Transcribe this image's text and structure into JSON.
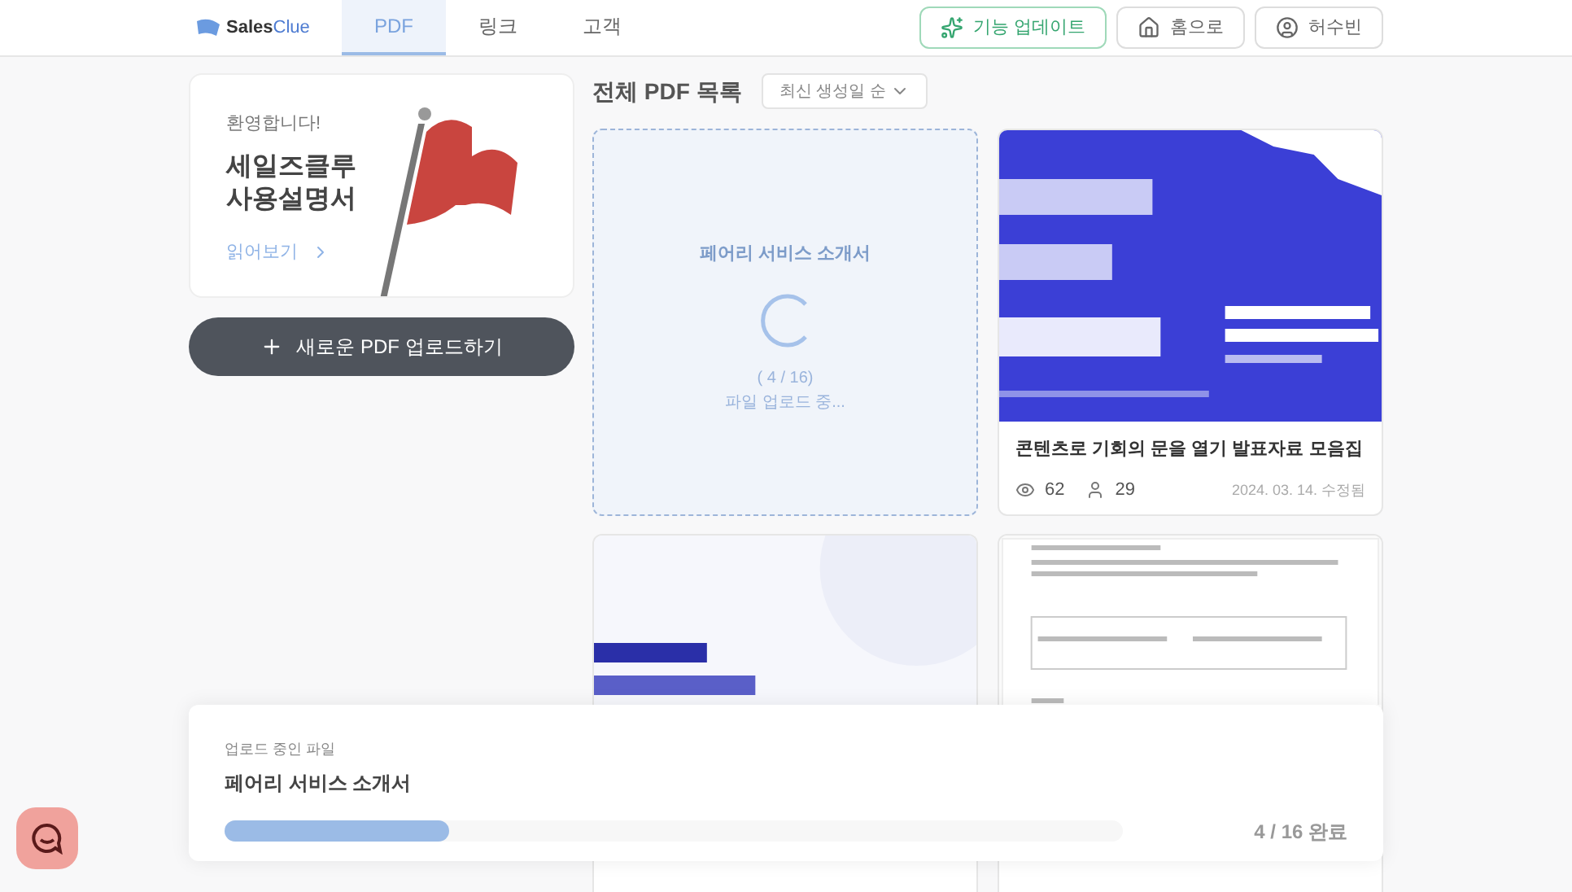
{
  "header": {
    "logo": {
      "prefix": "Sales",
      "suffix": "Clue"
    },
    "tabs": [
      {
        "label": "PDF",
        "selected": true
      },
      {
        "label": "링크",
        "selected": false
      },
      {
        "label": "고객",
        "selected": false
      }
    ],
    "actions": [
      {
        "kind": "update",
        "label": "기능 업데이트"
      },
      {
        "kind": "home",
        "label": "홈으로"
      },
      {
        "kind": "user",
        "label": "허수빈"
      }
    ]
  },
  "guide": {
    "greeting": "환영합니다!",
    "title": "세일즈클루\n사용설명서",
    "link": "읽어보기"
  },
  "upload_button": "새로운 PDF 업로드하기",
  "list": {
    "title": "전체 PDF 목록",
    "sort": "최신 생성일 순",
    "cards": [
      {
        "kind": "uploading",
        "name": "페어리 서비스 소개서",
        "progress": "( 4 / 16)",
        "status": "파일 업로드 중..."
      },
      {
        "kind": "pdf",
        "title": "콘텐츠로 기회의 문을 열기 발표자료 모음집",
        "views": "62",
        "visitors": "29",
        "date": "2024. 03. 14. 수정됨"
      },
      {
        "kind": "pdf"
      },
      {
        "kind": "pdf"
      }
    ]
  },
  "upload_panel": {
    "caption": "업로드 중인 파일",
    "file": "페어리 서비스 소개서",
    "level": 0.25,
    "count": "4 / 16 완료"
  }
}
